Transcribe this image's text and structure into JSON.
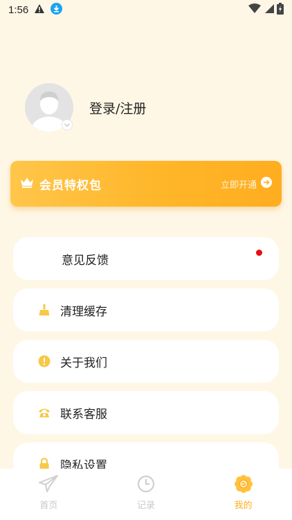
{
  "status_bar": {
    "time": "1:56",
    "icons": [
      "warning-icon",
      "download-icon",
      "wifi-icon",
      "signal-icon",
      "battery-icon"
    ]
  },
  "profile": {
    "login_label": "登录/注册"
  },
  "vip": {
    "title": "会员特权包",
    "action_label": "立即开通",
    "colors": {
      "start": "#FFC64A",
      "end": "#FFAD20"
    }
  },
  "menu": [
    {
      "label": "意见反馈",
      "icon": null,
      "badge": "red-dot"
    },
    {
      "label": "清理缓存",
      "icon": "broom-icon"
    },
    {
      "label": "关于我们",
      "icon": "info-alert-icon"
    },
    {
      "label": "联系客服",
      "icon": "phone-icon"
    },
    {
      "label": "隐私设置",
      "icon": "lock-icon"
    }
  ],
  "tabs": [
    {
      "label": "首页",
      "icon": "paper-plane-icon",
      "active": false
    },
    {
      "label": "记录",
      "icon": "clock-icon",
      "active": false
    },
    {
      "label": "我的",
      "icon": "flower-icon",
      "active": true
    }
  ],
  "colors": {
    "background": "#FFF7E6",
    "accent": "#FFB020",
    "icon_yellow": "#F7C948",
    "inactive": "#C8C8C8",
    "badge_red": "#E80E0E"
  }
}
